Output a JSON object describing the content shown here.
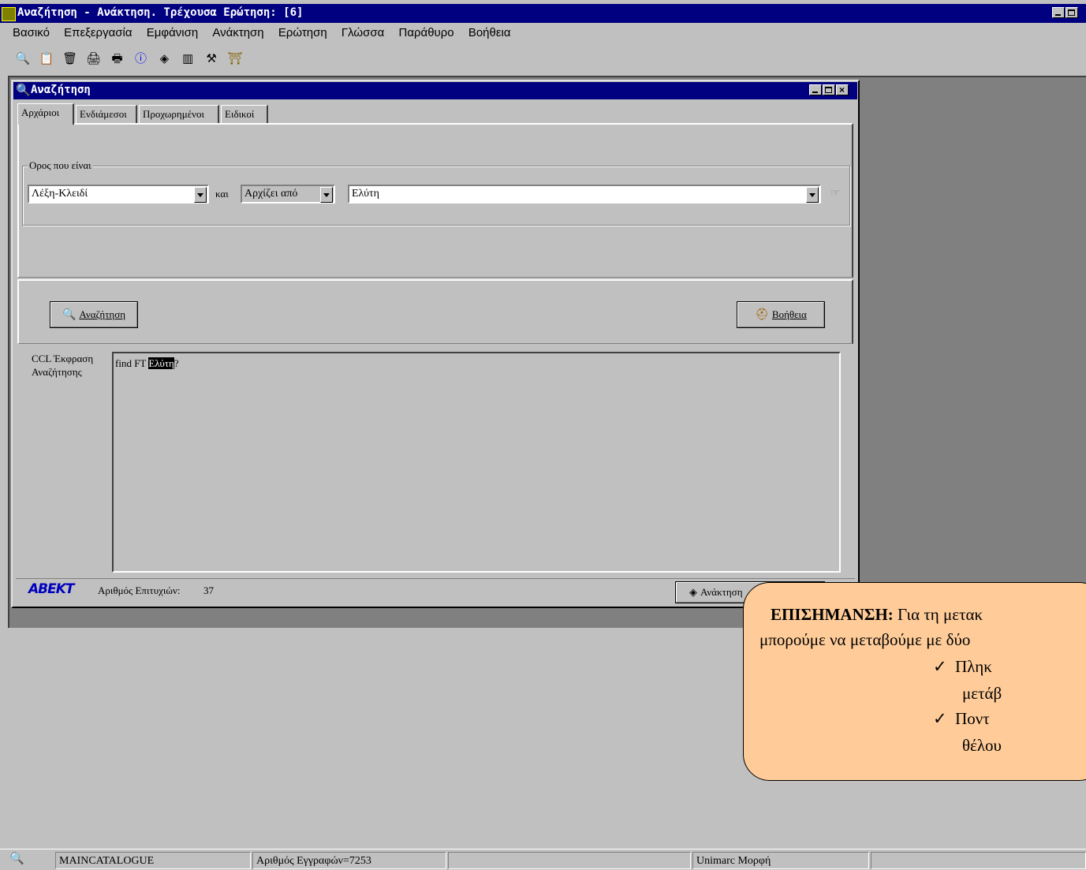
{
  "app": {
    "title": "Αναζήτηση - Ανάκτηση. Τρέχουσα Ερώτηση: [6]"
  },
  "menu": [
    "Βασικό",
    "Επεξεργασία",
    "Εμφάνιση",
    "Ανάκτηση",
    "Ερώτηση",
    "Γλώσσα",
    "Παράθυρο",
    "Βοήθεια"
  ],
  "toolbar": {
    "icons": [
      "search-records-icon",
      "copy-icon",
      "clear-icon",
      "print-icon",
      "print-preview-icon",
      "info-icon",
      "retrieve-icon",
      "barcode-icon",
      "tools-icon",
      "exit-icon"
    ]
  },
  "search_window": {
    "title": "Αναζήτηση",
    "tabs": [
      "Αρχάριοι",
      "Ενδιάμεσοι",
      "Προχωρημένοι",
      "Ειδικοί"
    ],
    "active_tab": "Αρχάριοι",
    "group_label": "Ορος που είναι",
    "field_select": "Λέξη-Κλειδί",
    "connector": "και",
    "match_select": "Αρχίζει από",
    "term_value": "Ελύτη",
    "search_button": "Αναζήτηση",
    "help_button": "Βοήθεια",
    "ccl_label_1": "CCL Έκφραση",
    "ccl_label_2": "Αναζήτησης",
    "ccl_prefix": "find FT",
    "ccl_term": "Ελύτη",
    "ccl_suffix": "?",
    "logo": "ABEKT",
    "hits_label": "Αριθμός Επιτυχιών:",
    "hits_value": "37",
    "retrieve_button": "Ανάκτηση"
  },
  "callout": {
    "bold": "ΕΠΙΣΗΜΑΝΣΗ:",
    "line1_rest": " Για τη μετακ",
    "line2": "μπορούμε να μεταβούμε με δύο",
    "bullet1_a": "Πληκ",
    "bullet1_b": "μετάβ",
    "bullet2_a": "Ποντ",
    "bullet2_b": "θέλου",
    "check": "✓",
    "fill": "#ffcc99"
  },
  "statusbar": {
    "database": "MAINCATALOGUE",
    "records": "Αριθμός Εγγραφών=7253",
    "empty": "",
    "format": "Unimarc Μορφή"
  },
  "colors": {
    "titlebar": "#000080",
    "face": "#c0c0c0",
    "workspace": "#808080"
  }
}
